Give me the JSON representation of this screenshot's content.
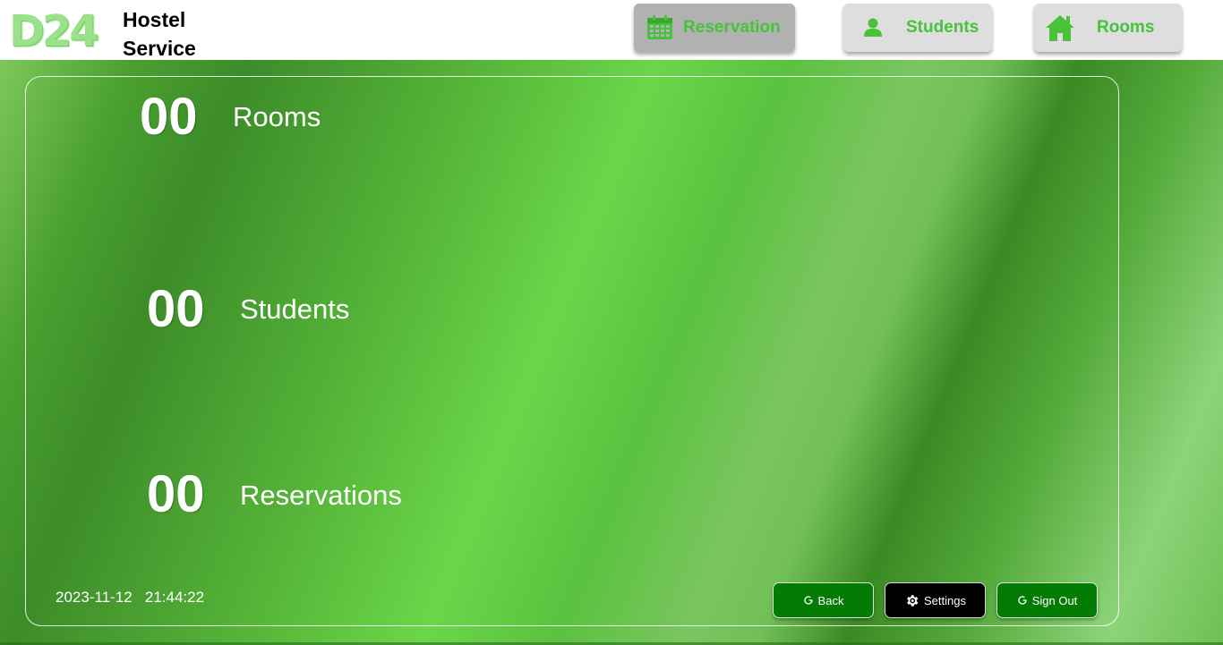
{
  "app": {
    "logo_mark": "D24",
    "logo_line1": "Hostel",
    "logo_line2": "Service"
  },
  "nav": {
    "reservation": {
      "label": "Reservation",
      "icon": "calendar-icon",
      "active": true
    },
    "students": {
      "label": "Students",
      "icon": "user-icon"
    },
    "rooms": {
      "label": "Rooms",
      "icon": "home-icon"
    }
  },
  "stats": {
    "rooms": {
      "count": "00",
      "label": "Rooms"
    },
    "students": {
      "count": "00",
      "label": "Students"
    },
    "reservations": {
      "count": "00",
      "label": "Reservations"
    }
  },
  "footer": {
    "date": "2023-11-12",
    "time": "21:44:22"
  },
  "actions": {
    "back": {
      "label": "Back",
      "icon": "refresh-icon"
    },
    "settings": {
      "label": "Settings",
      "icon": "gear-icon"
    },
    "sign_out": {
      "label": "Sign Out",
      "icon": "refresh-icon"
    }
  },
  "colors": {
    "accent_green": "#47c23a",
    "button_green": "#047c04",
    "nav_bg": "#dedede",
    "nav_active_bg": "#b1b1b1"
  }
}
